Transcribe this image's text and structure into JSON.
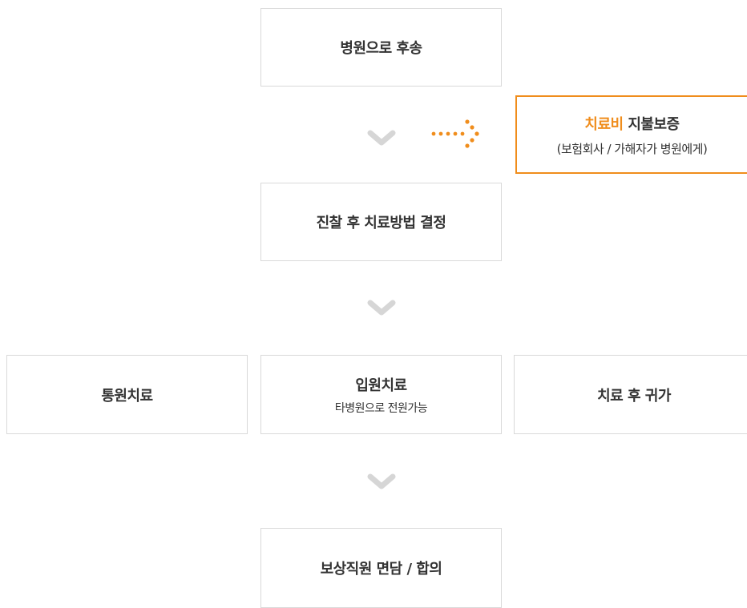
{
  "steps": {
    "hospital_transfer": "병원으로 후송",
    "diagnosis": "진찰 후 치료방법 결정",
    "outpatient": "통원치료",
    "inpatient": "입원치료",
    "inpatient_sub": "타병원으로 전원가능",
    "return_home": "치료 후 귀가",
    "settlement": "보상직원 면담 / 합의"
  },
  "guarantee": {
    "title_highlight": "치료비",
    "title_rest": " 지불보증",
    "subtitle": "(보험회사 / 가해자가 병원에게)"
  },
  "colors": {
    "accent": "#f08d1c",
    "border": "#d9d9d9",
    "chevron": "#d6d6d6",
    "text": "#333333"
  }
}
